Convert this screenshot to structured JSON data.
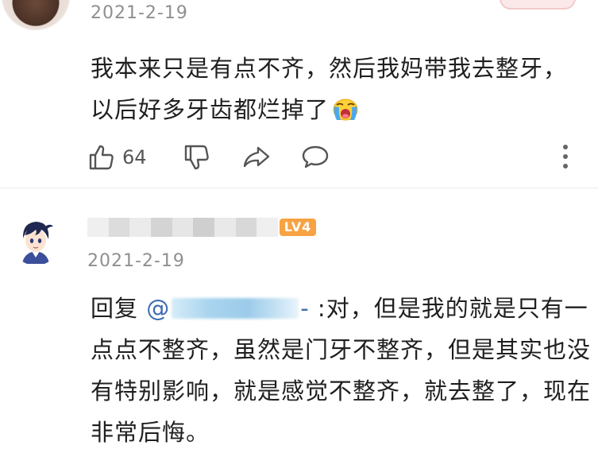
{
  "comment1": {
    "date": "2021-2-19",
    "text": "我本来只是有点不齐，然后我妈带我去整牙，以后好多牙齿都烂掉了",
    "emoji_icon": "crying-face-icon",
    "likes": "64"
  },
  "comment2": {
    "level_badge": "LV4",
    "date": "2021-2-19",
    "reply_prefix": "回复",
    "mention_at": "@",
    "mention_tail": "-",
    "text": ":对，但是我的就是只有一点点不整齐，虽然是门牙不整齐，但是其实也没有特别影响，就是感觉不整齐，就去整了，现在非常后悔。"
  },
  "colors": {
    "mention": "#3d6bb3",
    "badge": "#f7a343",
    "date": "#8f8f8f"
  }
}
